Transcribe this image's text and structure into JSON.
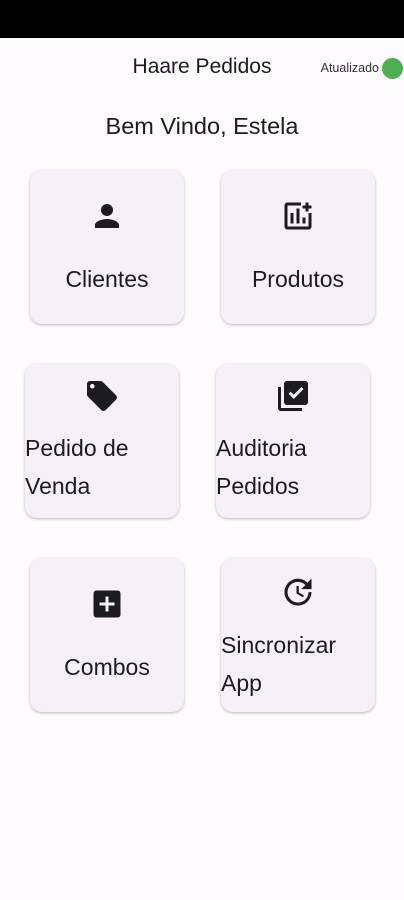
{
  "header": {
    "title": "Haare Pedidos",
    "sync_label": "Atualizado",
    "sync_color": "#4caf50"
  },
  "welcome": "Bem Vindo, Estela",
  "menu": [
    {
      "label": "Clientes",
      "icon": "person-icon"
    },
    {
      "label": "Produtos",
      "icon": "add-chart-icon"
    },
    {
      "label": "Pedido de Venda",
      "icon": "sell-tag-icon"
    },
    {
      "label": "Auditoria Pedidos",
      "icon": "library-add-check-icon"
    },
    {
      "label": "Combos",
      "icon": "add-box-icon"
    },
    {
      "label": "Sincronizar App",
      "icon": "sync-clock-icon"
    }
  ]
}
